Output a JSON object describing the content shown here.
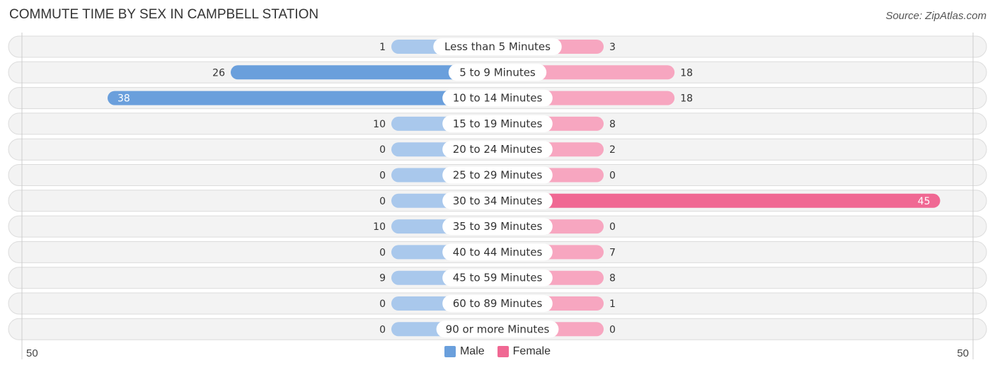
{
  "chart_data": {
    "type": "bar",
    "orientation": "horizontal-diverging",
    "title": "COMMUTE TIME BY SEX IN CAMPBELL STATION",
    "source": "Source: ZipAtlas.com",
    "categories": [
      "Less than 5 Minutes",
      "5 to 9 Minutes",
      "10 to 14 Minutes",
      "15 to 19 Minutes",
      "20 to 24 Minutes",
      "25 to 29 Minutes",
      "30 to 34 Minutes",
      "35 to 39 Minutes",
      "40 to 44 Minutes",
      "45 to 59 Minutes",
      "60 to 89 Minutes",
      "90 or more Minutes"
    ],
    "series": [
      {
        "name": "Male",
        "color": "#6a9fdc",
        "light_color": "#a9c8ec",
        "values": [
          1,
          26,
          38,
          10,
          0,
          0,
          0,
          10,
          0,
          9,
          0,
          0
        ]
      },
      {
        "name": "Female",
        "color": "#f06893",
        "light_color": "#f7a6c0",
        "values": [
          3,
          18,
          18,
          8,
          2,
          0,
          45,
          0,
          7,
          8,
          1,
          0
        ]
      }
    ],
    "axis": {
      "left_label": "50",
      "right_label": "50",
      "range": [
        -50,
        50
      ]
    },
    "legend": {
      "position": "bottom-center",
      "items": [
        "Male",
        "Female"
      ]
    },
    "grid": false
  }
}
